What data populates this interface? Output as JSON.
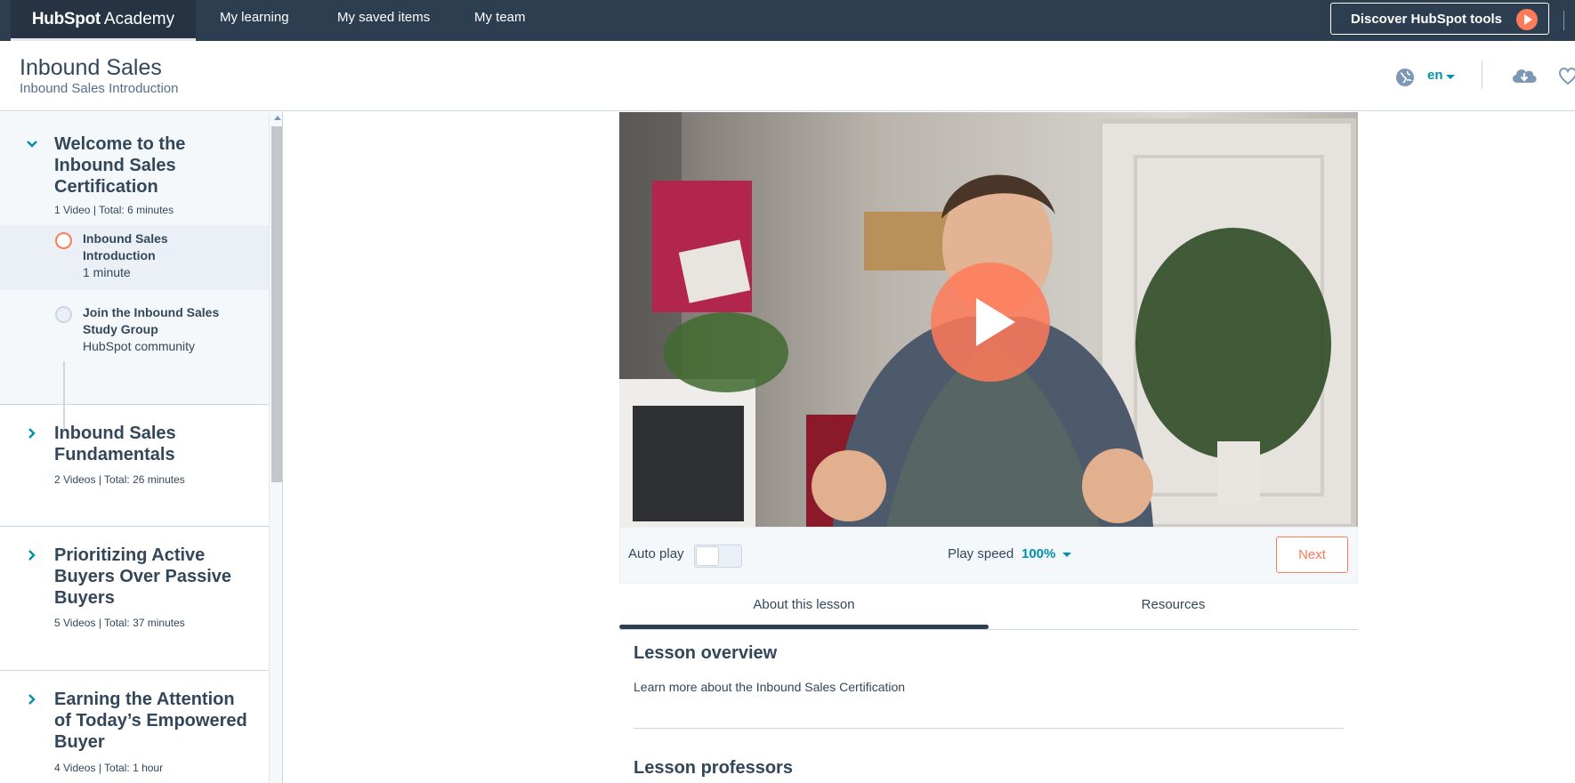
{
  "nav": {
    "brand_bold": "HubSpot",
    "brand_rest": "Academy",
    "links": [
      "My learning",
      "My saved items",
      "My team"
    ],
    "cta_label": "Discover HubSpot tools"
  },
  "header": {
    "title": "Inbound Sales",
    "subtitle": "Inbound Sales Introduction",
    "language": "en"
  },
  "sidebar": {
    "modules": [
      {
        "title": "Welcome to the Inbound Sales Certification",
        "meta": "1 Video | Total: 6 minutes",
        "expanded": true,
        "lessons": [
          {
            "title": "Inbound Sales Introduction",
            "meta": "1 minute",
            "active": true
          },
          {
            "title": "Join the Inbound Sales Study Group",
            "meta": "HubSpot community",
            "active": false
          }
        ]
      },
      {
        "title": "Inbound Sales Fundamentals",
        "meta": "2 Videos | Total: 26 minutes",
        "expanded": false
      },
      {
        "title": "Prioritizing Active Buyers Over Passive Buyers",
        "meta": "5 Videos | Total: 37 minutes",
        "expanded": false
      },
      {
        "title": "Earning the Attention of Today’s Empowered Buyer",
        "meta": "4 Videos | Total: 1 hour",
        "expanded": false
      }
    ]
  },
  "player": {
    "autoplay_label": "Auto play",
    "speed_label": "Play speed",
    "speed_value": "100%",
    "next_label": "Next",
    "autoplay_on": false
  },
  "tabs": [
    "About this lesson",
    "Resources"
  ],
  "content": {
    "overview_title": "Lesson overview",
    "overview_text": "Learn more about the Inbound Sales Certification",
    "professors_title": "Lesson professors"
  },
  "colors": {
    "accent": "#ff7a59",
    "nav_bg": "#2d3e50",
    "link": "#0091ae"
  }
}
